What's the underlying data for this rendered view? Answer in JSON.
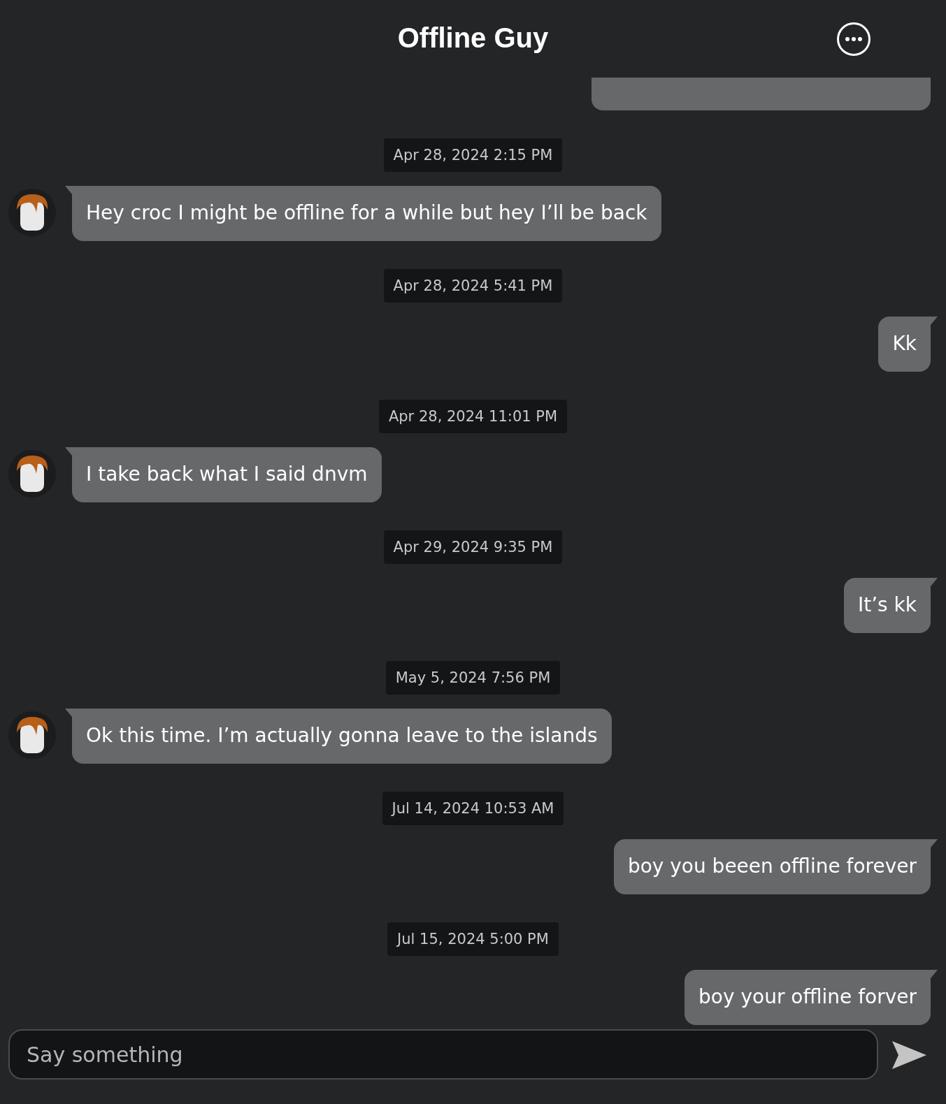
{
  "header": {
    "title": "Offline Guy"
  },
  "messages": [
    {
      "kind": "outgoing"
    },
    {
      "kind": "timestamp",
      "text": "Apr 28, 2024 2:15 PM"
    },
    {
      "kind": "incoming",
      "text": "Hey croc I might be offline for a while but hey I’ll be back"
    },
    {
      "kind": "timestamp",
      "text": "Apr 28, 2024 5:41 PM"
    },
    {
      "kind": "outgoing",
      "text": "Kk"
    },
    {
      "kind": "timestamp",
      "text": "Apr 28, 2024 11:01 PM"
    },
    {
      "kind": "incoming",
      "text": "I take back what I said dnvm"
    },
    {
      "kind": "timestamp",
      "text": "Apr 29, 2024 9:35 PM"
    },
    {
      "kind": "outgoing",
      "text": "It’s kk"
    },
    {
      "kind": "timestamp",
      "text": "May 5, 2024 7:56 PM"
    },
    {
      "kind": "incoming",
      "text": "Ok this time. I’m actually gonna leave to the islands"
    },
    {
      "kind": "timestamp",
      "text": "Jul 14, 2024 10:53 AM"
    },
    {
      "kind": "outgoing",
      "text": "boy you beeen offline forever"
    },
    {
      "kind": "timestamp",
      "text": "Jul 15, 2024 5:00 PM"
    },
    {
      "kind": "outgoing",
      "text": "boy your offline forver"
    }
  ],
  "composer": {
    "placeholder": "Say something"
  }
}
